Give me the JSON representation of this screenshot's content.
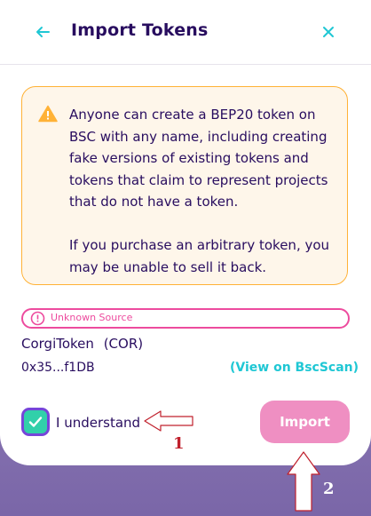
{
  "header": {
    "title": "Import Tokens"
  },
  "warning": {
    "paragraph1": "Anyone can create a BEP20 token on BSC with any name, including creating fake versions of existing tokens and tokens that claim to represent projects that do not have a token.",
    "paragraph2": "If you purchase an arbitrary token, you may be unable to sell it back."
  },
  "source_badge": {
    "label": "Unknown Source"
  },
  "token": {
    "name": "CorgiToken",
    "symbol": "(COR)",
    "address": "0x35...f1DB",
    "explorer_link": "(View on BscScan)"
  },
  "acknowledge": {
    "label": "I understand",
    "checked": true
  },
  "import_button": {
    "label": "Import"
  },
  "annotations": {
    "label1": "1",
    "label2": "2"
  },
  "colors": {
    "primary_text": "#280d5f",
    "accent": "#1fc7d4",
    "failure": "#ed4b9e",
    "warning": "#ffb237",
    "success": "#31d0aa",
    "secondary": "#7645d9"
  }
}
